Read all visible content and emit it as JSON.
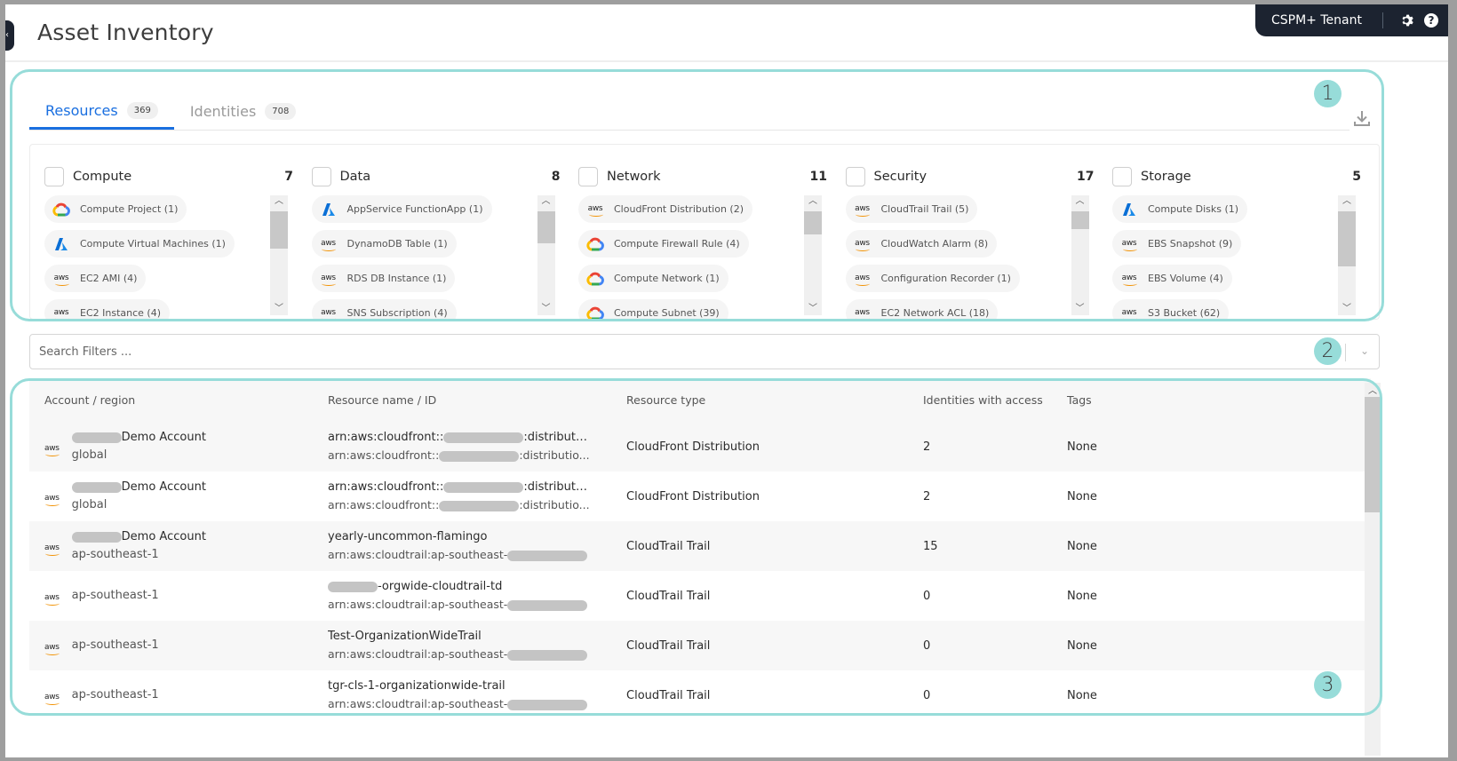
{
  "header": {
    "title": "Asset Inventory",
    "tenant": "CSPM+ Tenant",
    "settings_icon": "gear-icon",
    "help_icon": "help-icon",
    "help_glyph": "?",
    "collapse_glyph": "‹"
  },
  "callouts": [
    "1",
    "2",
    "3"
  ],
  "tabs": [
    {
      "label": "Resources",
      "count": "369",
      "active": true
    },
    {
      "label": "Identities",
      "count": "708",
      "active": false
    }
  ],
  "categories": [
    {
      "name": "Compute",
      "count": "7",
      "chips": [
        {
          "provider": "gcp",
          "label": "Compute Project (1)"
        },
        {
          "provider": "azure",
          "label": "Compute Virtual Machines (1)"
        },
        {
          "provider": "aws",
          "label": "EC2 AMI (4)"
        },
        {
          "provider": "aws",
          "label": "EC2 Instance (4)"
        }
      ]
    },
    {
      "name": "Data",
      "count": "8",
      "chips": [
        {
          "provider": "azure",
          "label": "AppService FunctionApp (1)"
        },
        {
          "provider": "aws",
          "label": "DynamoDB Table (1)"
        },
        {
          "provider": "aws",
          "label": "RDS DB Instance (1)"
        },
        {
          "provider": "aws",
          "label": "SNS Subscription (4)"
        }
      ]
    },
    {
      "name": "Network",
      "count": "11",
      "chips": [
        {
          "provider": "aws",
          "label": "CloudFront Distribution (2)"
        },
        {
          "provider": "gcp",
          "label": "Compute Firewall Rule (4)"
        },
        {
          "provider": "gcp",
          "label": "Compute Network (1)"
        },
        {
          "provider": "gcp",
          "label": "Compute Subnet (39)"
        }
      ]
    },
    {
      "name": "Security",
      "count": "17",
      "chips": [
        {
          "provider": "aws",
          "label": "CloudTrail Trail (5)"
        },
        {
          "provider": "aws",
          "label": "CloudWatch Alarm (8)"
        },
        {
          "provider": "aws",
          "label": "Configuration Recorder (1)"
        },
        {
          "provider": "aws",
          "label": "EC2 Network ACL (18)"
        }
      ]
    },
    {
      "name": "Storage",
      "count": "5",
      "chips": [
        {
          "provider": "azure",
          "label": "Compute Disks (1)"
        },
        {
          "provider": "aws",
          "label": "EBS Snapshot (9)"
        },
        {
          "provider": "aws",
          "label": "EBS Volume (4)"
        },
        {
          "provider": "aws",
          "label": "S3 Bucket (62)"
        }
      ]
    }
  ],
  "search": {
    "placeholder": "Search Filters ..."
  },
  "table": {
    "columns": [
      "Account / region",
      "Resource name / ID",
      "Resource type",
      "Identities with access",
      "Tags"
    ],
    "rows": [
      {
        "account": "Demo Account",
        "region": "global",
        "res1_pre": "arn:aws:cloudfront::",
        "res1_post": ":distributio...",
        "res2_pre": "arn:aws:cloudfront::",
        "res2_post": ":distributio...",
        "type": "CloudFront Distribution",
        "identities": "2",
        "tags": "None"
      },
      {
        "account": "Demo Account",
        "region": "global",
        "res1_pre": "arn:aws:cloudfront::",
        "res1_post": ":distributio...",
        "res2_pre": "arn:aws:cloudfront::",
        "res2_post": ":distributio...",
        "type": "CloudFront Distribution",
        "identities": "2",
        "tags": "None"
      },
      {
        "account": "Demo Account",
        "region": "ap-southeast-1",
        "res1_pre": "yearly-uncommon-flamingo",
        "res1_post": "",
        "res2_pre": "arn:aws:cloudtrail:ap-southeast-",
        "res2_post": "",
        "type": "CloudTrail Trail",
        "identities": "15",
        "tags": "None"
      },
      {
        "account": "",
        "region": "ap-southeast-1",
        "res1_pre": "",
        "res1_post": "-orgwide-cloudtrail-td",
        "res2_pre": "arn:aws:cloudtrail:ap-southeast-",
        "res2_post": "",
        "type": "CloudTrail Trail",
        "identities": "0",
        "tags": "None"
      },
      {
        "account": "",
        "region": "ap-southeast-1",
        "res1_pre": "Test-OrganizationWideTrail",
        "res1_post": "",
        "res2_pre": "arn:aws:cloudtrail:ap-southeast-",
        "res2_post": "",
        "type": "CloudTrail Trail",
        "identities": "0",
        "tags": "None"
      },
      {
        "account": "",
        "region": "ap-southeast-1",
        "res1_pre": "tgr-cls-1-organizationwide-trail",
        "res1_post": "",
        "res2_pre": "arn:aws:cloudtrail:ap-southeast-",
        "res2_post": "",
        "type": "CloudTrail Trail",
        "identities": "0",
        "tags": "None"
      }
    ]
  },
  "colors": {
    "accent": "#1a6fe0",
    "callout": "#97dcd9",
    "header_dark": "#1c2330",
    "aws_orange": "#f29100",
    "azure_blue": "#0a6fd6"
  }
}
